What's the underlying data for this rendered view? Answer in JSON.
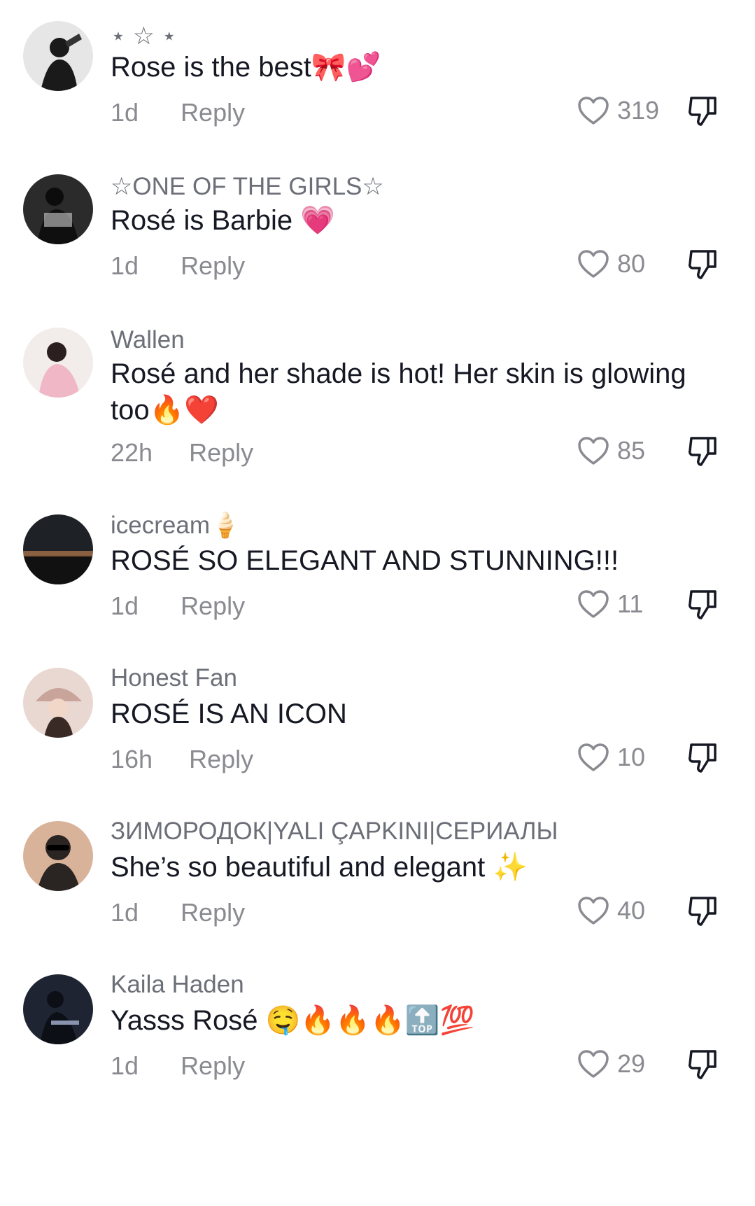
{
  "comments": [
    {
      "username": "⋆ ☆ ⋆",
      "text": "Rose is the best🎀💕",
      "time": "1d",
      "reply": "Reply",
      "likes": "319",
      "avatar_colors": [
        "#1a1a1a",
        "#d9d9d9"
      ]
    },
    {
      "username": "☆ONE OF THE GIRLS☆",
      "text": "Rosé is Barbie 💗",
      "time": "1d",
      "reply": "Reply",
      "likes": "80",
      "avatar_colors": [
        "#111111",
        "#9a9a9a"
      ]
    },
    {
      "username": "Wallen",
      "text": "Rosé and her shade is hot! Her skin is glowing too🔥❤️",
      "time": "22h",
      "reply": "Reply",
      "likes": "85",
      "avatar_colors": [
        "#f3e2e6",
        "#2b1f1f"
      ]
    },
    {
      "username": "icecream🍦",
      "text": "ROSÉ SO ELEGANT AND STUNNING!!!",
      "time": "1d",
      "reply": "Reply",
      "likes": "11",
      "avatar_colors": [
        "#1e2226",
        "#b77b4f"
      ]
    },
    {
      "username": "Honest Fan",
      "text": "ROSÉ IS AN ICON",
      "time": "16h",
      "reply": "Reply",
      "likes": "10",
      "avatar_colors": [
        "#c9a49a",
        "#3a2a25"
      ]
    },
    {
      "username": "ЗИМОРОДОК|YALI ÇAPKINI|СЕРИАЛЫ",
      "text": "She’s so beautiful and elegant ✨",
      "time": "1d",
      "reply": "Reply",
      "likes": "40",
      "avatar_colors": [
        "#2a2522",
        "#d8b39a"
      ]
    },
    {
      "username": "Kaila  Haden",
      "text": "Yasss Rosé 🤤🔥🔥🔥🔝💯",
      "time": "1d",
      "reply": "Reply",
      "likes": "29",
      "avatar_colors": [
        "#1f2433",
        "#8a93ad"
      ]
    }
  ],
  "icons": {
    "like": "heart-outline-icon",
    "dislike": "thumbs-down-icon"
  },
  "colors": {
    "text": "#161823",
    "muted": "#8a8b91",
    "username": "#6c6f78"
  }
}
